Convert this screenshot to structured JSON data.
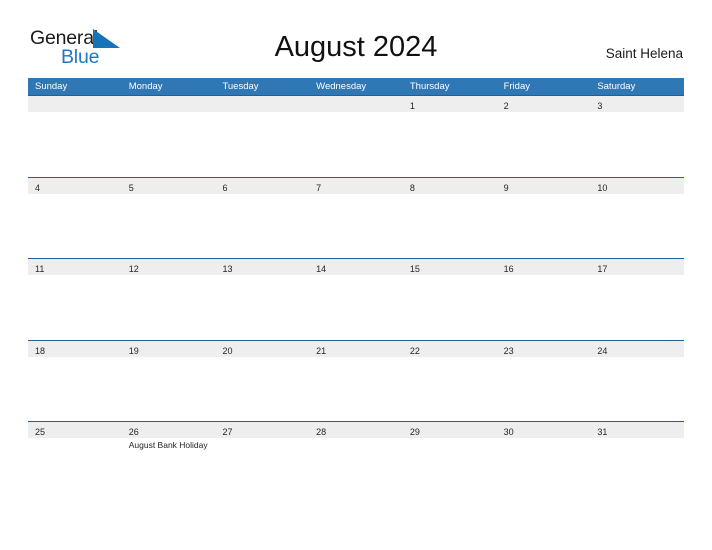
{
  "brand": {
    "line1": "General",
    "line2": "Blue",
    "mark_icon": "triangle-flag-icon",
    "accent_color": "#2176c7"
  },
  "header": {
    "title": "August 2024",
    "location": "Saint Helena"
  },
  "calendar": {
    "header_bg": "#3077b6",
    "row_divider_color": "#1f5f9c",
    "day_band_bg": "#eeeeee",
    "weekdays": [
      "Sunday",
      "Monday",
      "Tuesday",
      "Wednesday",
      "Thursday",
      "Friday",
      "Saturday"
    ],
    "weeks": [
      [
        {
          "date": ""
        },
        {
          "date": ""
        },
        {
          "date": ""
        },
        {
          "date": ""
        },
        {
          "date": "1"
        },
        {
          "date": "2"
        },
        {
          "date": "3"
        }
      ],
      [
        {
          "date": "4"
        },
        {
          "date": "5"
        },
        {
          "date": "6"
        },
        {
          "date": "7"
        },
        {
          "date": "8"
        },
        {
          "date": "9"
        },
        {
          "date": "10"
        }
      ],
      [
        {
          "date": "11"
        },
        {
          "date": "12"
        },
        {
          "date": "13"
        },
        {
          "date": "14"
        },
        {
          "date": "15"
        },
        {
          "date": "16"
        },
        {
          "date": "17"
        }
      ],
      [
        {
          "date": "18"
        },
        {
          "date": "19"
        },
        {
          "date": "20"
        },
        {
          "date": "21"
        },
        {
          "date": "22"
        },
        {
          "date": "23"
        },
        {
          "date": "24"
        }
      ],
      [
        {
          "date": "25"
        },
        {
          "date": "26",
          "event": "August Bank Holiday"
        },
        {
          "date": "27"
        },
        {
          "date": "28"
        },
        {
          "date": "29"
        },
        {
          "date": "30"
        },
        {
          "date": "31"
        }
      ]
    ]
  }
}
